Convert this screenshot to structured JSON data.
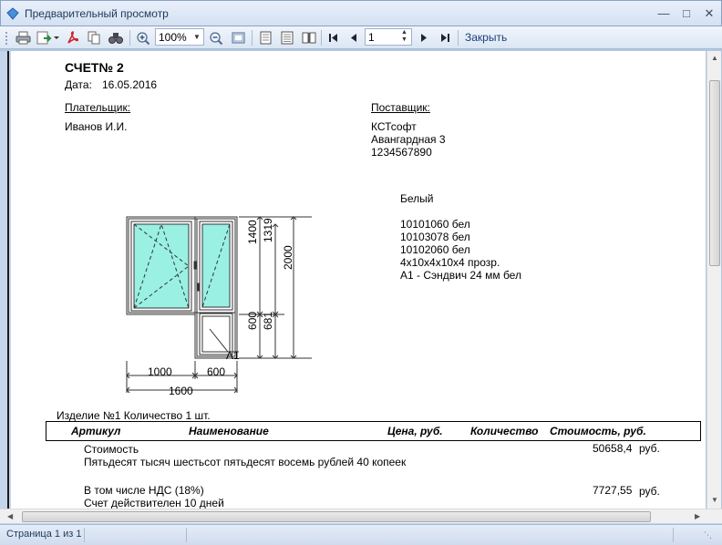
{
  "window": {
    "title": "Предварительный просмотр"
  },
  "toolbar": {
    "zoom_value": "100%",
    "page_value": "1",
    "close_label": "Закрыть"
  },
  "status": {
    "page_info": "Страница 1 из 1"
  },
  "invoice": {
    "title": "СЧЕТ№  2",
    "date_label": "Дата:",
    "date_value": "16.05.2016",
    "payer_label": "Плательщик:",
    "payer_name": "Иванов И.И.",
    "supplier_label": "Поставщик:",
    "supplier_lines": [
      "КСТсофт",
      "Авангардная 3",
      "1234567890"
    ],
    "spec_lines": [
      "Белый",
      "10101060 бел",
      "10103078 бел",
      "10102060 бел",
      "4х10х4х10х4 прозр.",
      "А1 - Сэндвич 24 мм бел"
    ],
    "dimensions": {
      "w_left": "1000",
      "w_right": "600",
      "w_total": "1600",
      "h_upper": "1400",
      "h_inner": "1319",
      "h_total": "2000",
      "h_lower": "600",
      "h_lower_inner": "681",
      "panel_label": "А1"
    },
    "item_label": "Изделие №1  Количество  1 шт.",
    "table_headers": [
      "Артикул",
      "Наименование",
      "Цена,  руб.",
      "Количество",
      "Стоимость,  руб."
    ],
    "cost_label": "Стоимость",
    "cost_value": "50658,4",
    "currency": "руб.",
    "cost_words": "Пятьдесят тысяч шестьсот пятьдесят восемь рублей 40 копеек",
    "vat_label": "В том числе НДС (18%)",
    "vat_value": "7727,55",
    "validity": "Счет действителен 10 дней"
  }
}
